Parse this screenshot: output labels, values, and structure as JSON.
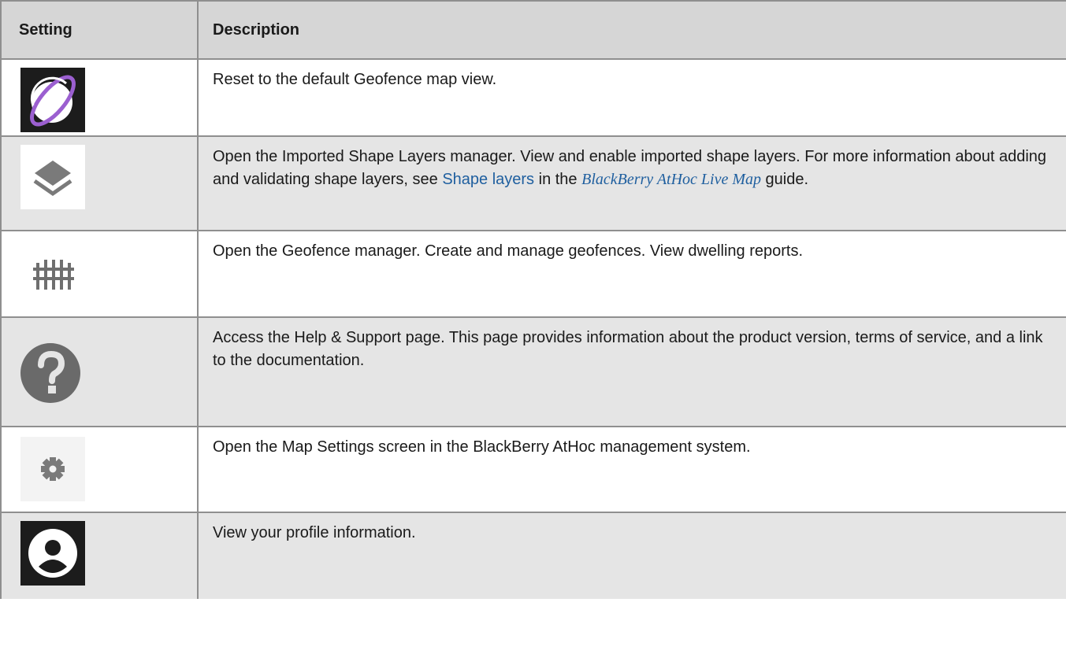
{
  "table": {
    "headers": {
      "setting": "Setting",
      "description": "Description"
    },
    "rows": [
      {
        "icon": "globe-reset-icon",
        "description": "Reset to the default Geofence map view."
      },
      {
        "icon": "layers-icon",
        "text_before_link": "Open the Imported Shape Layers manager. View and enable imported shape layers. For more information about adding and validating shape layers, see ",
        "link_text": "Shape layers",
        "text_after_link": " in the ",
        "guide_title": "BlackBerry AtHoc Live Map",
        "text_end": " guide."
      },
      {
        "icon": "fence-icon",
        "description": "Open the Geofence manager. Create and manage geofences. View dwelling reports."
      },
      {
        "icon": "help-icon",
        "description": "Access the Help & Support page. This page provides information about the product version, terms of service, and a link to the documentation."
      },
      {
        "icon": "gear-icon",
        "description": "Open the Map Settings screen in the BlackBerry AtHoc management system."
      },
      {
        "icon": "profile-icon",
        "description": "View your profile information."
      }
    ]
  },
  "colors": {
    "header_bg": "#d6d6d6",
    "alt_row_bg": "#e5e5e5",
    "border": "#8f8f8f",
    "link": "#1f5f9f",
    "globe_accent": "#9b5fd0"
  }
}
